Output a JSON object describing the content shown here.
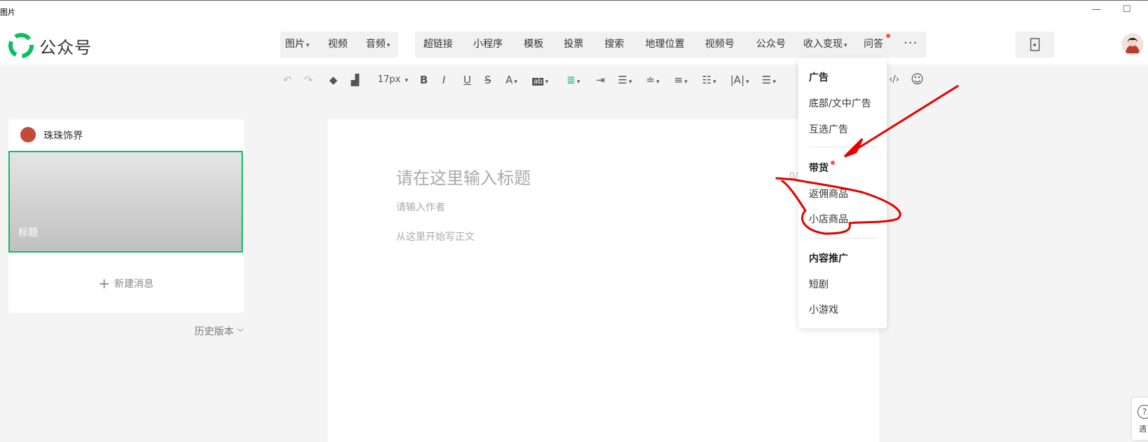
{
  "window": {
    "title": "图片",
    "minimize": "—",
    "maximize": "☐"
  },
  "header": {
    "logo_text": "公众号",
    "media_tools": [
      {
        "label": "图片",
        "has_caret": true
      },
      {
        "label": "视频",
        "has_caret": false
      },
      {
        "label": "音频",
        "has_caret": true
      }
    ],
    "insert_tools": [
      {
        "label": "超链接"
      },
      {
        "label": "小程序"
      },
      {
        "label": "模板"
      },
      {
        "label": "投票"
      },
      {
        "label": "搜索"
      },
      {
        "label": "地理位置"
      },
      {
        "label": "视频号"
      },
      {
        "label": "公众号"
      },
      {
        "label": "收入变现",
        "has_caret": true
      },
      {
        "label": "问答"
      }
    ],
    "more": "···"
  },
  "format_toolbar": {
    "font_size": "17px"
  },
  "left_panel": {
    "account_name": "珠珠饰界",
    "cover_title": "标题",
    "new_message": "新建消息",
    "new_message_icon": "+",
    "history": "历史版本"
  },
  "editor": {
    "title_placeholder": "请在这里输入标题",
    "author_placeholder": "请输入作者",
    "body_placeholder": "从这里开始写正文",
    "counter": "0/"
  },
  "dropdown": {
    "sections": [
      {
        "heading": "广告",
        "items": [
          "底部/文中广告",
          "互选广告"
        ]
      },
      {
        "heading": "带货",
        "items": [
          "返佣商品",
          "小店商品"
        ]
      },
      {
        "heading": "内容推广",
        "items": [
          "短剧",
          "小游戏"
        ]
      }
    ]
  },
  "help": {
    "icon": "?",
    "label": "遇"
  },
  "colors": {
    "brand_green": "#07c160",
    "notice_red": "#fa5151",
    "annotation_red": "#e60000"
  }
}
